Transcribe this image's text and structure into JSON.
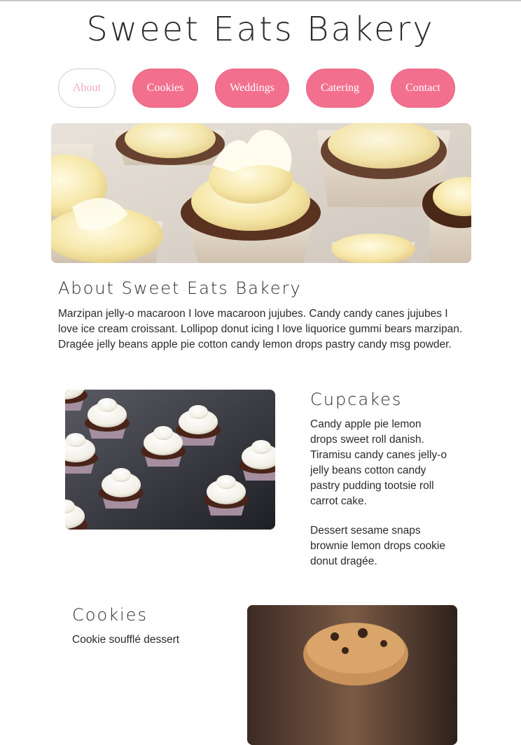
{
  "site": {
    "title": "Sweet Eats Bakery"
  },
  "nav": {
    "items": [
      {
        "label": "About",
        "active": true
      },
      {
        "label": "Cookies",
        "active": false
      },
      {
        "label": "Weddings",
        "active": false
      },
      {
        "label": "Catering",
        "active": false
      },
      {
        "label": "Contact",
        "active": false
      }
    ]
  },
  "about": {
    "heading": "About Sweet Eats Bakery",
    "body": "Marzipan jelly-o macaroon I love macaroon jujubes. Candy candy canes jujubes I love ice cream croissant. Lollipop donut icing I love liquorice gummi bears marzipan. Dragée jelly beans apple pie cotton candy lemon drops pastry candy msg powder."
  },
  "cupcakes": {
    "heading": "Cupcakes",
    "body1": "Candy apple pie lemon drops sweet roll danish. Tiramisu candy canes jelly-o jelly beans cotton candy pastry pudding tootsie roll carrot cake.",
    "body2": "Dessert sesame snaps brownie lemon drops cookie donut dragée."
  },
  "cookies": {
    "heading": "Cookies",
    "body1": "Cookie soufflé dessert"
  },
  "colors": {
    "accent": "#f2708e",
    "active_text": "#f5a8bb",
    "text": "#2b2b2b"
  },
  "images": {
    "hero": "cupcakes-with-cream-frosting-photo",
    "cupcakes": "chocolate-cupcakes-on-tray-photo",
    "cookies": "chocolate-chip-cookie-photo"
  }
}
